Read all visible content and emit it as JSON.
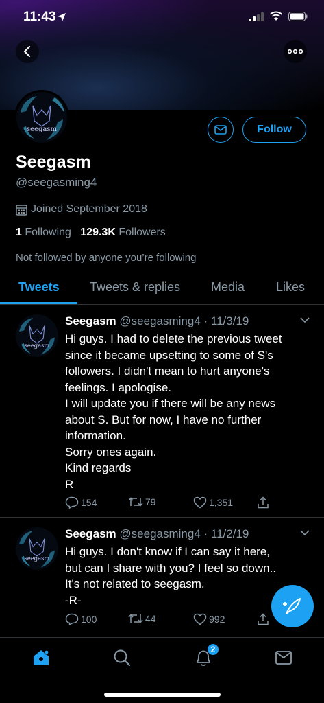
{
  "status_bar": {
    "time": "11:43"
  },
  "profile": {
    "name": "Seegasm",
    "handle": "@seegasming4",
    "avatar_text": "seegasm",
    "joined": "Joined September 2018",
    "following_count": "1",
    "following_label": "Following",
    "followers_count": "129.3K",
    "followers_label": "Followers",
    "not_followed": "Not followed by anyone you’re following",
    "follow_label": "Follow"
  },
  "tabs": [
    {
      "label": "Tweets",
      "active": true
    },
    {
      "label": "Tweets & replies"
    },
    {
      "label": "Media"
    },
    {
      "label": "Likes"
    }
  ],
  "tweets": [
    {
      "name": "Seegasm",
      "meta": "@seegasming4 · 11/3/19",
      "lines": [
        "Hi guys. I had to delete the previous tweet",
        "since it became upsetting to some of S's",
        "followers. I didn't mean to hurt anyone's",
        "feelings. I apologise.",
        "I will update you if there will be any news",
        "about S. But for now, I have no further",
        "information.",
        "Sorry ones again.",
        "Kind regards",
        "R"
      ],
      "replies": "154",
      "retweets": "79",
      "likes": "1,351"
    },
    {
      "name": "Seegasm",
      "meta": "@seegasming4 · 11/2/19",
      "lines": [
        "Hi guys. I don't know if I can say it here,",
        "but can I share with you? I feel so down..",
        "It's not related to seegasm.",
        "-R-"
      ],
      "replies": "100",
      "retweets": "44",
      "likes": "992"
    }
  ],
  "nav": {
    "notifications_badge": "2"
  },
  "colors": {
    "accent": "#1da1f2",
    "secondary_text": "#8899a6",
    "background": "#000000"
  }
}
